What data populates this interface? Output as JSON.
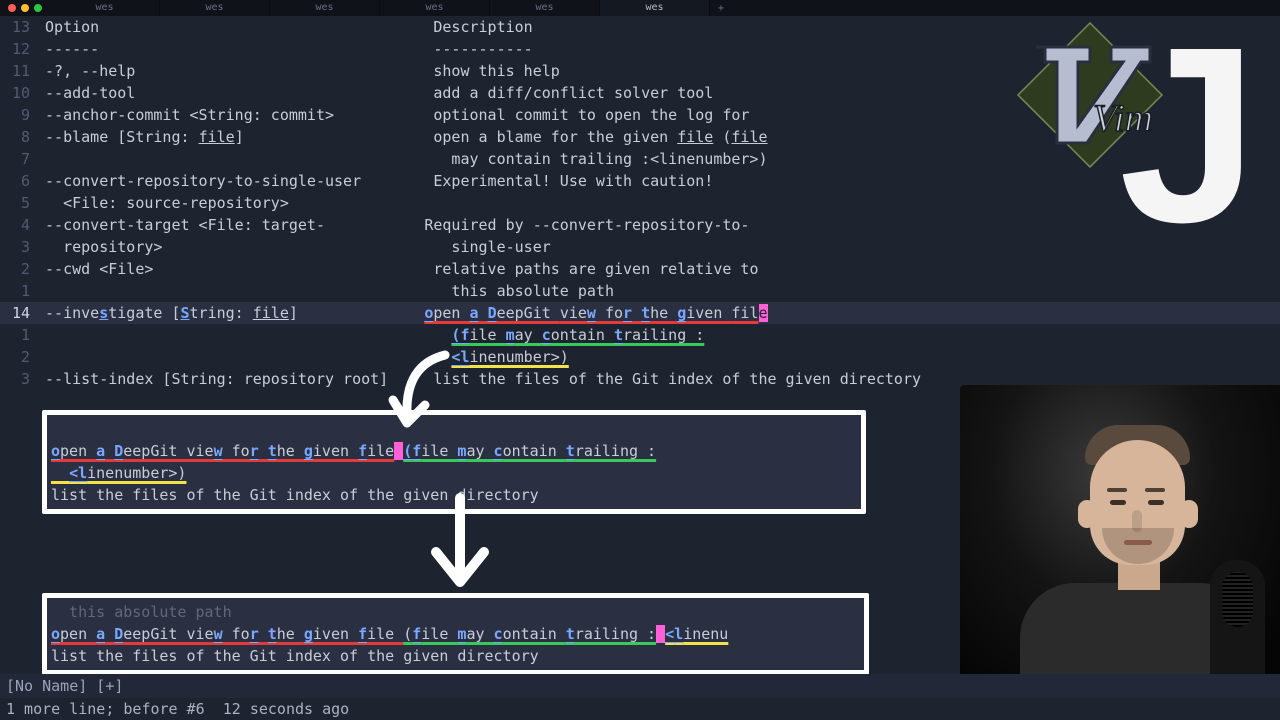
{
  "tabs": {
    "name": "wes",
    "items": [
      "wes",
      "wes",
      "wes",
      "wes",
      "wes",
      "wes"
    ],
    "active_index": 5
  },
  "gutter": [
    "13",
    "12",
    "11",
    "10",
    "9",
    "8",
    "7",
    "6",
    "5",
    "4",
    "3",
    "2",
    "1",
    "14",
    "1",
    "2",
    "3"
  ],
  "lines": {
    "l13_a": "Option",
    "l13_b": "Description",
    "l12_a": "------",
    "l12_b": "-----------",
    "l11_a": "-?, --help",
    "l11_b": "show this help",
    "l10_a": "--add-tool",
    "l10_b": "add a diff/conflict solver tool",
    "l9_a": "--anchor-commit <String: commit>",
    "l9_b": "optional commit to open the log for",
    "l8_a1": "--blame [String: ",
    "l8_a_file": "file",
    "l8_a2": "]",
    "l8_b1": "open a blame for the given ",
    "l8_b_file1": "file",
    "l8_b2": " (",
    "l8_b_file2": "file",
    "l7_b": "  may contain trailing :<linenumber>)",
    "l6_a": "--convert-repository-to-single-user",
    "l6_b": "Experimental! Use with caution!",
    "l5_a": "  <File: source-repository>",
    "l4_a": "--convert-target <File: target-",
    "l4_b": "Required by --convert-repository-to-",
    "l3_a": "  repository>",
    "l3_b": "  single-user",
    "l2_a": "--cwd <File>",
    "l2_b": "relative paths are given relative to",
    "l1_b": "  this absolute path",
    "l14_a1": "--inve",
    "l14_a_hop1": "s",
    "l14_a2": "tigate [",
    "l14_a_hop2": "S",
    "l14_a3": "tring: ",
    "l14_a_file": "file",
    "l14_a4": "]",
    "l14_seg": {
      "open": "o",
      "pen": "pen ",
      "a": "a",
      " ": " ",
      "D": "D",
      "eepGit": "eepGit ",
      "view": "vie",
      "w": "w",
      " fo": " fo",
      "r": "r",
      "t": "t",
      "he": "he ",
      "g": "g",
      "iven": "iven ",
      "fil": "fil",
      "e": "e"
    },
    "r1_seg": {
      "lp": "(",
      "f": "f",
      "ile": "ile ",
      "m": "m",
      "ay": "ay ",
      "c": "c",
      "ontain": "ontain ",
      "t": "t",
      "railing": "railing :"
    },
    "r2_seg": {
      "lt": "<",
      "l": "l",
      "inenumber": "inenumber>)"
    },
    "lli_a": "--list-index [String: repository root]",
    "lli_b": "list the files of the Git index of the given directory"
  },
  "frame1": {
    "line1": "open a DeepGit view for the given file (file may contain trailing :",
    "line2": "  <linenumber>)",
    "line3": "list the files of the Git index of the given directory"
  },
  "frame2": {
    "prev": "  this absolute path",
    "line1_pre": "open a DeepGit view for the given file (file may contain trailing :",
    "line1_post": "<linenu",
    "line2": "list the files of the Git index of the given directory"
  },
  "status": "[No Name] [+]",
  "msg": "1 more line; before #6  12 seconds ago",
  "key": "J",
  "logo_text": "Vim"
}
